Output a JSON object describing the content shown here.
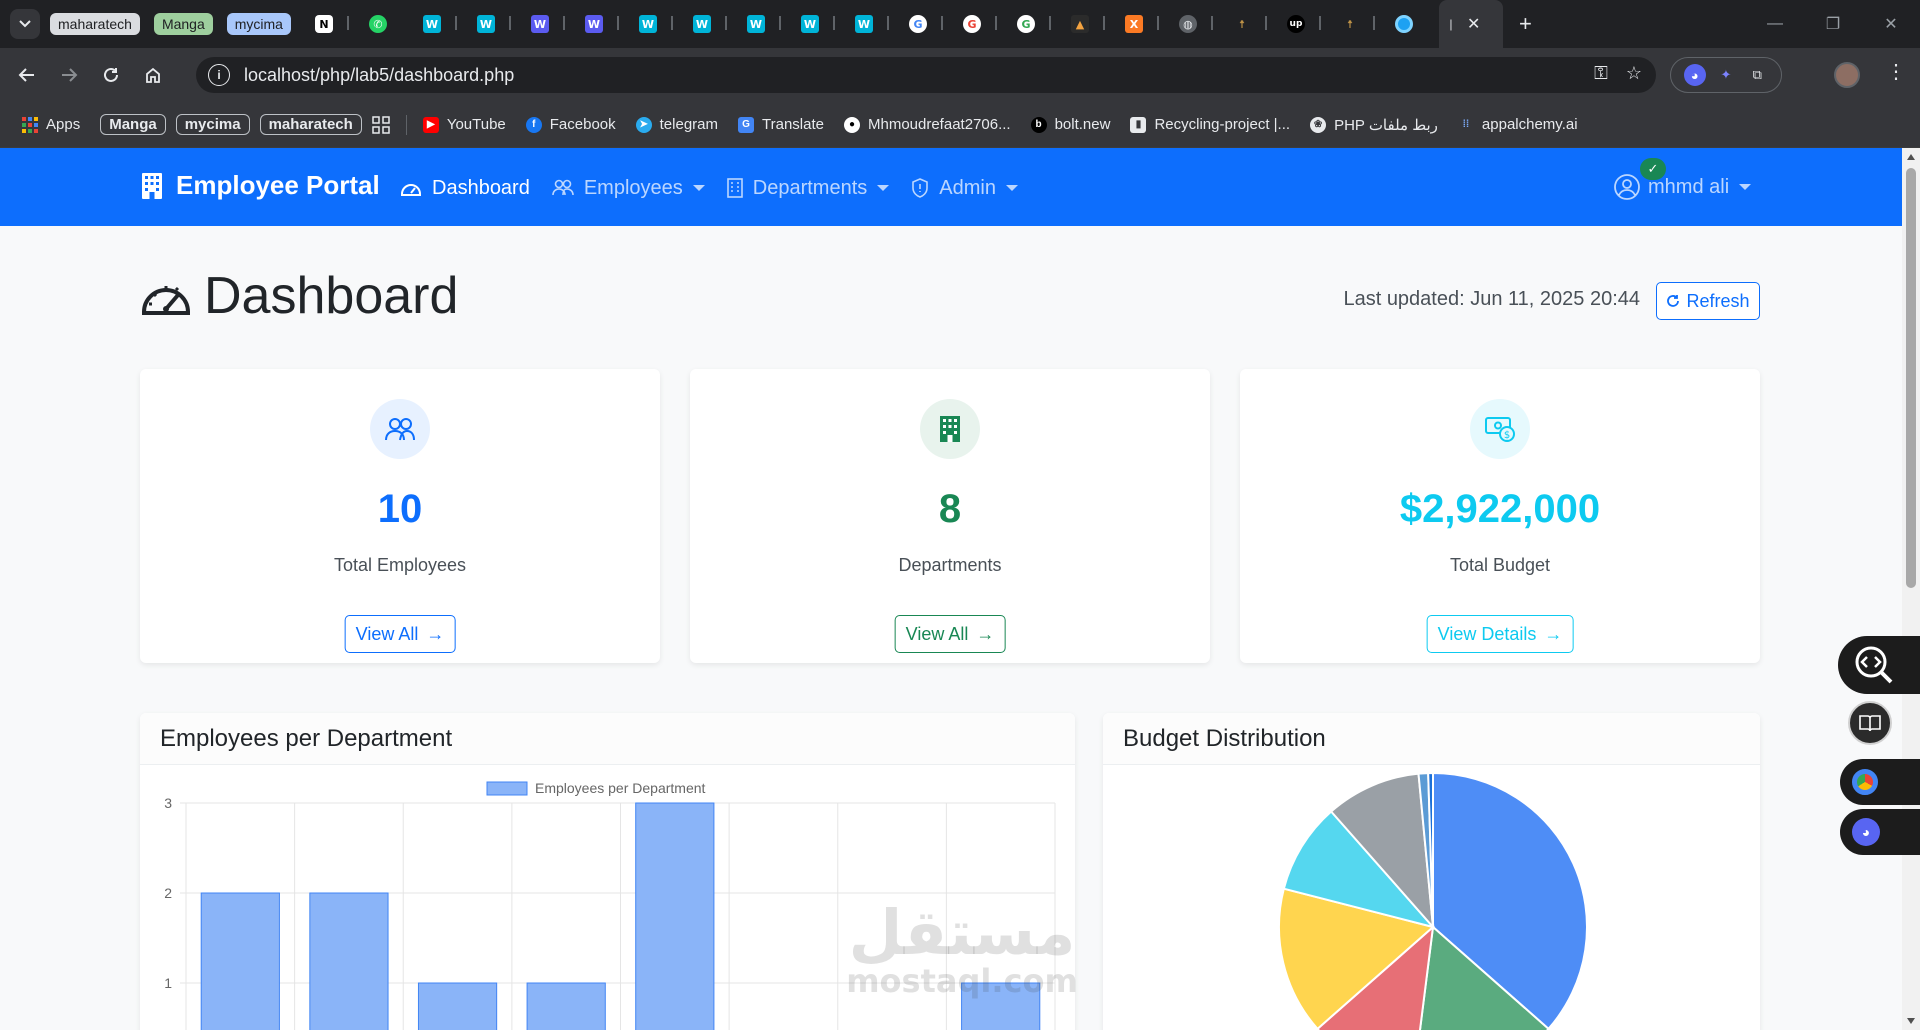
{
  "browser": {
    "tab_chips": [
      "maharatech",
      "Manga",
      "mycima"
    ],
    "address_url": "localhost/php/lab5/dashboard.php",
    "bookmarks": {
      "apps": "Apps",
      "chips": [
        "Manga",
        "mycima",
        "maharatech"
      ],
      "links": [
        "YouTube",
        "Facebook",
        "telegram",
        "Translate",
        "Mhmoudrefaat2706...",
        "bolt.new",
        "Recycling-project |...",
        "PHP ربط ملفات",
        "appalchemy.ai"
      ]
    }
  },
  "navbar": {
    "brand": "Employee Portal",
    "links": [
      {
        "label": "Dashboard",
        "active": true
      },
      {
        "label": "Employees",
        "dropdown": true
      },
      {
        "label": "Departments",
        "dropdown": true
      },
      {
        "label": "Admin",
        "dropdown": true
      }
    ],
    "user": "mhmd ali"
  },
  "header": {
    "title": "Dashboard",
    "last_updated": "Last updated: Jun 11, 2025 20:44",
    "refresh_label": "Refresh"
  },
  "stats": [
    {
      "value": "10",
      "label": "Total Employees",
      "button": "View All",
      "color": "#0d6efd",
      "icon": "people-icon"
    },
    {
      "value": "8",
      "label": "Departments",
      "button": "View All",
      "color": "#198754",
      "icon": "building-icon"
    },
    {
      "value": "$2,922,000",
      "label": "Total Budget",
      "button": "View Details",
      "color": "#0dcaf0",
      "icon": "cash-icon"
    }
  ],
  "charts": {
    "bar_title": "Employees per Department",
    "pie_title": "Budget Distribution"
  },
  "watermark": {
    "arabic": "مستقل",
    "latin": "mostaql.com"
  },
  "chart_data": [
    {
      "type": "bar",
      "legend": [
        "Employees per Department"
      ],
      "series": [
        {
          "name": "Employees per Department",
          "values": [
            2,
            2,
            1,
            1,
            3,
            0,
            0,
            1
          ]
        }
      ],
      "y_ticks": [
        1,
        2,
        3
      ],
      "colors": {
        "fill": "#8ab4f8",
        "stroke": "#4285f4"
      }
    },
    {
      "type": "pie",
      "series": [
        {
          "values": [
            36.5,
            15.5,
            11.5,
            15.5,
            9.5,
            10,
            1,
            0.5
          ]
        }
      ],
      "colors": [
        "#4e8df6",
        "#5aab7f",
        "#e76f76",
        "#ffd54f",
        "#55d7ef",
        "#9aa0a6",
        "#5b9bd5",
        "#1b6fd8"
      ]
    }
  ]
}
